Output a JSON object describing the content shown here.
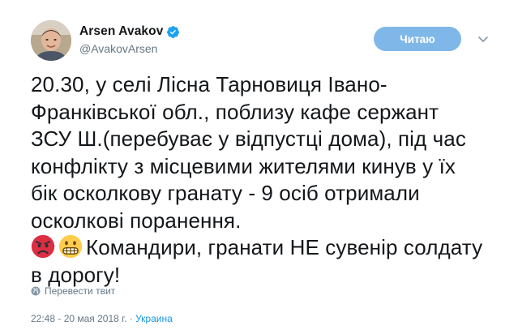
{
  "author": {
    "display_name": "Arsen Avakov",
    "handle": "@AvakovArsen",
    "verified": true
  },
  "follow_button": {
    "label": "Читаю",
    "color": "#7fb8e8"
  },
  "tweet": {
    "lines": [
      "20.30, у селі Лісна Тарновиця Івано-Франківської обл., поблизу кафе сержант ЗСУ Ш.(перебуває у відпустці дома), під час конфлікту з місцевими жителями кинув у їх бік осколкову гранату - 9 осіб отримали осколкові поранення.",
      "Командири, гранати НЕ сувенір солдату в дорогу!"
    ],
    "emojis": [
      "angry-face",
      "grimacing-face"
    ]
  },
  "translate": {
    "label": "Перевести твит",
    "icon": "globe-icon"
  },
  "meta": {
    "timestamp": "22:48 - 20 мая 2018 г.",
    "separator": "·",
    "location": "Украина"
  },
  "colors": {
    "text": "#14171a",
    "secondary": "#657786",
    "link": "#1b95e0",
    "verified": "#1da1f2"
  }
}
